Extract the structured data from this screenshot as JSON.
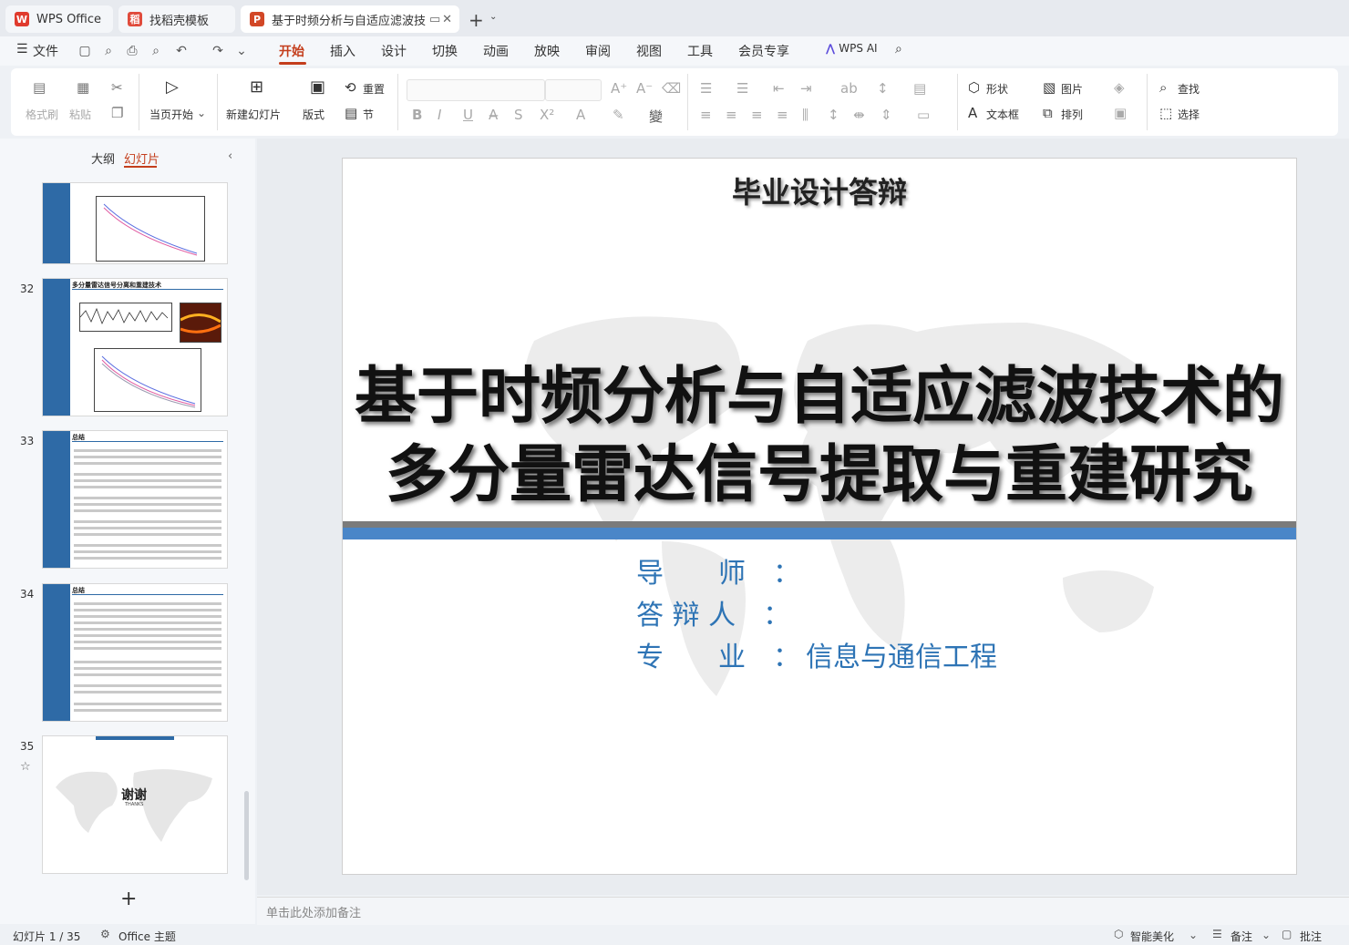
{
  "tabs": {
    "wps_office": "WPS Office",
    "daoke": "找稻壳模板",
    "document": "基于时频分析与自适应滤波技"
  },
  "menu": {
    "file": "文件",
    "items": [
      "开始",
      "插入",
      "设计",
      "切换",
      "动画",
      "放映",
      "审阅",
      "视图",
      "工具",
      "会员专享"
    ],
    "wps_ai": "WPS AI"
  },
  "ribbon": {
    "format_brush": "格式刷",
    "paste": "粘贴",
    "from_current": "当页开始",
    "new_slide": "新建幻灯片",
    "layout": "版式",
    "reset": "重置",
    "section": "节",
    "shape": "形状",
    "picture": "图片",
    "find": "查找",
    "textbox": "文本框",
    "arrange": "排列",
    "select": "选择"
  },
  "left_panel": {
    "outline_tab": "大纲",
    "slides_tab": "幻灯片",
    "slide_numbers": [
      "32",
      "33",
      "34",
      "35"
    ],
    "thumb32_title": "多分量雷达信号分离和重建技术",
    "thumb33_title": "总结",
    "thumb34_title": "总结",
    "thumb35_title": "谢谢",
    "thumb35_sub": "THANKS"
  },
  "slide": {
    "header": "毕业设计答辩",
    "title_line1": "基于时频分析与自适应滤波技术的",
    "title_line2": "多分量雷达信号提取与重建研究",
    "advisor_label": "导　　师　：",
    "defender_label": "答 辩 人　：",
    "major_label": "专　　业　：",
    "major_value": "信息与通信工程"
  },
  "notes_placeholder": "单击此处添加备注",
  "status": {
    "slide_counter": "幻灯片 1 / 35",
    "theme": "Office 主题",
    "beautify": "智能美化",
    "notes": "备注",
    "comments": "批注"
  },
  "colors": {
    "accent": "#c43e1c",
    "slide_blue": "#4a86c8",
    "label_blue": "#2e74b5"
  }
}
